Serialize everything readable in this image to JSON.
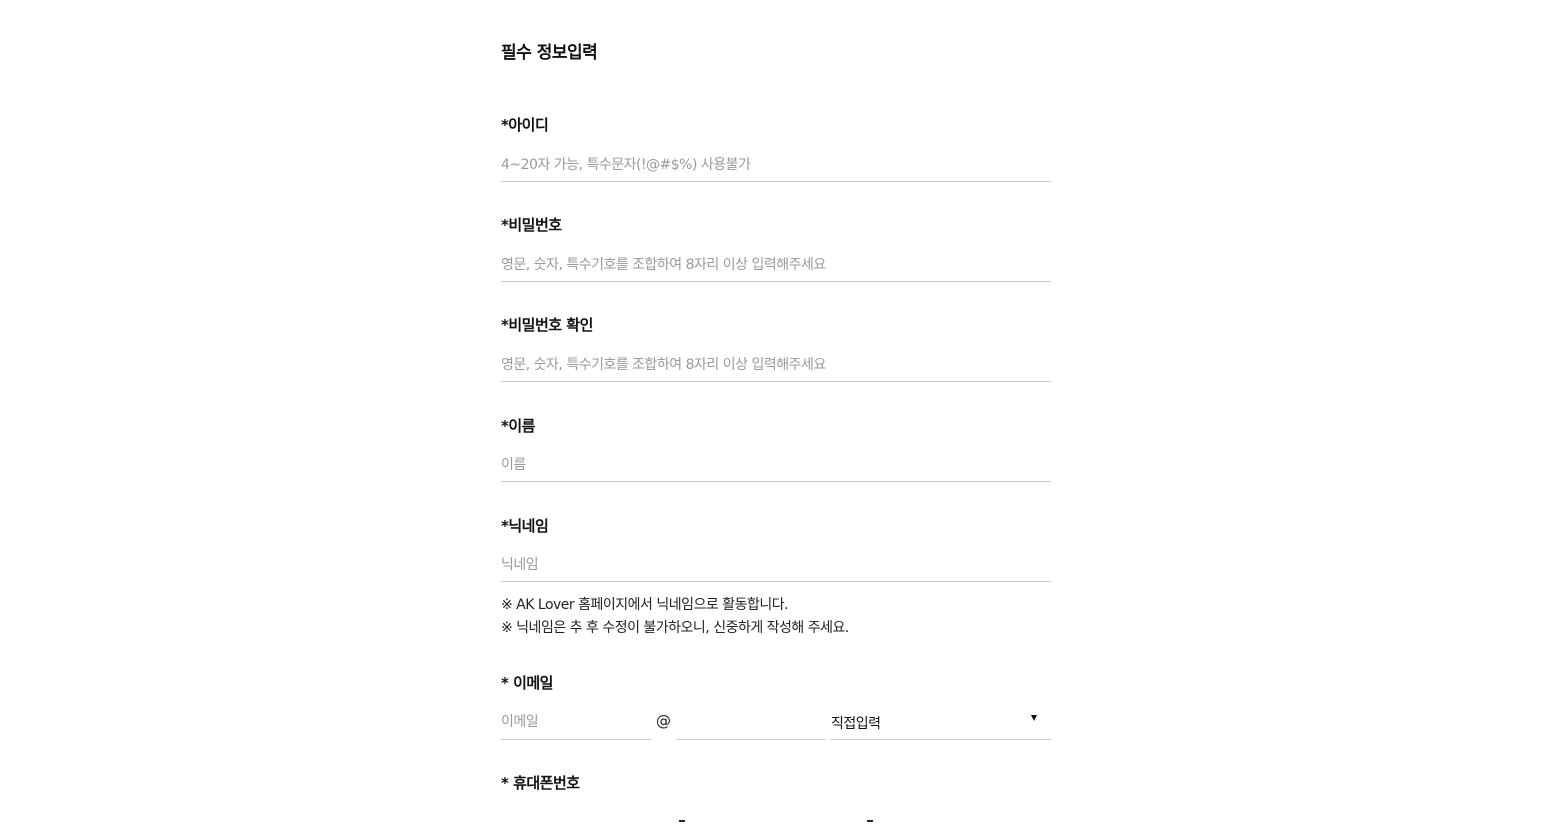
{
  "section_title": "필수 정보입력",
  "fields": {
    "id": {
      "label": "*아이디",
      "placeholder": "4~20자 가능, 특수문자(!@#$%) 사용불가"
    },
    "password": {
      "label": "*비밀번호",
      "placeholder": "영문, 숫자, 특수기호를 조합하여 8자리 이상 입력해주세요"
    },
    "password_confirm": {
      "label": "*비밀번호 확인",
      "placeholder": "영문, 숫자, 특수기호를 조합하여 8자리 이상 입력해주세요"
    },
    "name": {
      "label": "*이름",
      "placeholder": "이름"
    },
    "nickname": {
      "label": "*닉네임",
      "placeholder": "닉네임",
      "notes": [
        "※ AK Lover 홈페이지에서 닉네임으로 활동합니다.",
        "※ 닉네임은 추 후 수정이 불가하오니, 신중하게 작성해 주세요."
      ]
    },
    "email": {
      "label": "* 이메일",
      "local_placeholder": "이메일",
      "at_symbol": "@",
      "domain_value": "",
      "domain_select_value": "직접입력"
    },
    "phone": {
      "label": "* 휴대폰번호"
    }
  },
  "colors": {
    "text": "#111111",
    "placeholder": "#9a9a9a",
    "underline": "#cccccc"
  }
}
